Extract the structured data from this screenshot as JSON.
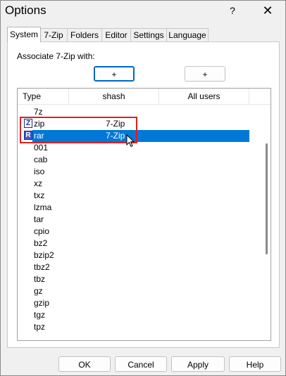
{
  "window": {
    "title": "Options",
    "help_button": "?",
    "close_button": "✕"
  },
  "tabs": [
    {
      "label": "System",
      "active": true
    },
    {
      "label": "7-Zip",
      "active": false
    },
    {
      "label": "Folders",
      "active": false
    },
    {
      "label": "Editor",
      "active": false
    },
    {
      "label": "Settings",
      "active": false
    },
    {
      "label": "Language",
      "active": false
    }
  ],
  "system": {
    "associate_label": "Associate 7-Zip with:",
    "add_button_1": "+",
    "add_button_2": "+",
    "columns": [
      "Type",
      "shash",
      "All users"
    ],
    "rows": [
      {
        "type": "7z",
        "shash": "",
        "icon": ""
      },
      {
        "type": "zip",
        "shash": "7-Zip",
        "icon": "Z"
      },
      {
        "type": "rar",
        "shash": "7-Zip",
        "icon": "R",
        "selected": true
      },
      {
        "type": "001",
        "shash": "",
        "icon": ""
      },
      {
        "type": "cab",
        "shash": "",
        "icon": ""
      },
      {
        "type": "iso",
        "shash": "",
        "icon": ""
      },
      {
        "type": "xz",
        "shash": "",
        "icon": ""
      },
      {
        "type": "txz",
        "shash": "",
        "icon": ""
      },
      {
        "type": "lzma",
        "shash": "",
        "icon": ""
      },
      {
        "type": "tar",
        "shash": "",
        "icon": ""
      },
      {
        "type": "cpio",
        "shash": "",
        "icon": ""
      },
      {
        "type": "bz2",
        "shash": "",
        "icon": ""
      },
      {
        "type": "bzip2",
        "shash": "",
        "icon": ""
      },
      {
        "type": "tbz2",
        "shash": "",
        "icon": ""
      },
      {
        "type": "tbz",
        "shash": "",
        "icon": ""
      },
      {
        "type": "gz",
        "shash": "",
        "icon": ""
      },
      {
        "type": "gzip",
        "shash": "",
        "icon": ""
      },
      {
        "type": "tgz",
        "shash": "",
        "icon": ""
      },
      {
        "type": "tpz",
        "shash": "",
        "icon": ""
      }
    ]
  },
  "footer": {
    "ok": "OK",
    "cancel": "Cancel",
    "apply": "Apply",
    "help": "Help"
  },
  "colors": {
    "selection": "#0078d7",
    "highlight_box": "#e0201f",
    "focus_border": "#0067c0"
  }
}
